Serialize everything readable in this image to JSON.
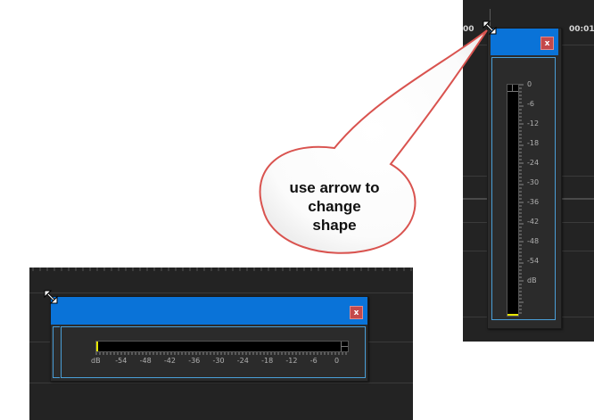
{
  "timeline": {
    "timecode_left": "00",
    "timecode_right": "00:01"
  },
  "vertical_meter": {
    "close_label": "x",
    "scale": [
      "0",
      "-6",
      "-12",
      "-18",
      "-24",
      "-30",
      "-36",
      "-42",
      "-48",
      "-54",
      "dB"
    ]
  },
  "horizontal_meter": {
    "close_label": "x",
    "scale": [
      "dB",
      "-54",
      "-48",
      "-42",
      "-36",
      "-30",
      "-24",
      "-18",
      "-12",
      "-6",
      "0"
    ]
  },
  "callout": {
    "line1": "use arrow  to",
    "line2": "change",
    "line3": "shape"
  },
  "colors": {
    "title_bar": "#0a73d8",
    "close_button": "#c4494a",
    "panel_border": "#4a9fd8",
    "callout_stroke": "#d9534f",
    "meter_peak": "#e6e600"
  },
  "icons": [
    "resize-diagonal-icon",
    "close-icon"
  ]
}
